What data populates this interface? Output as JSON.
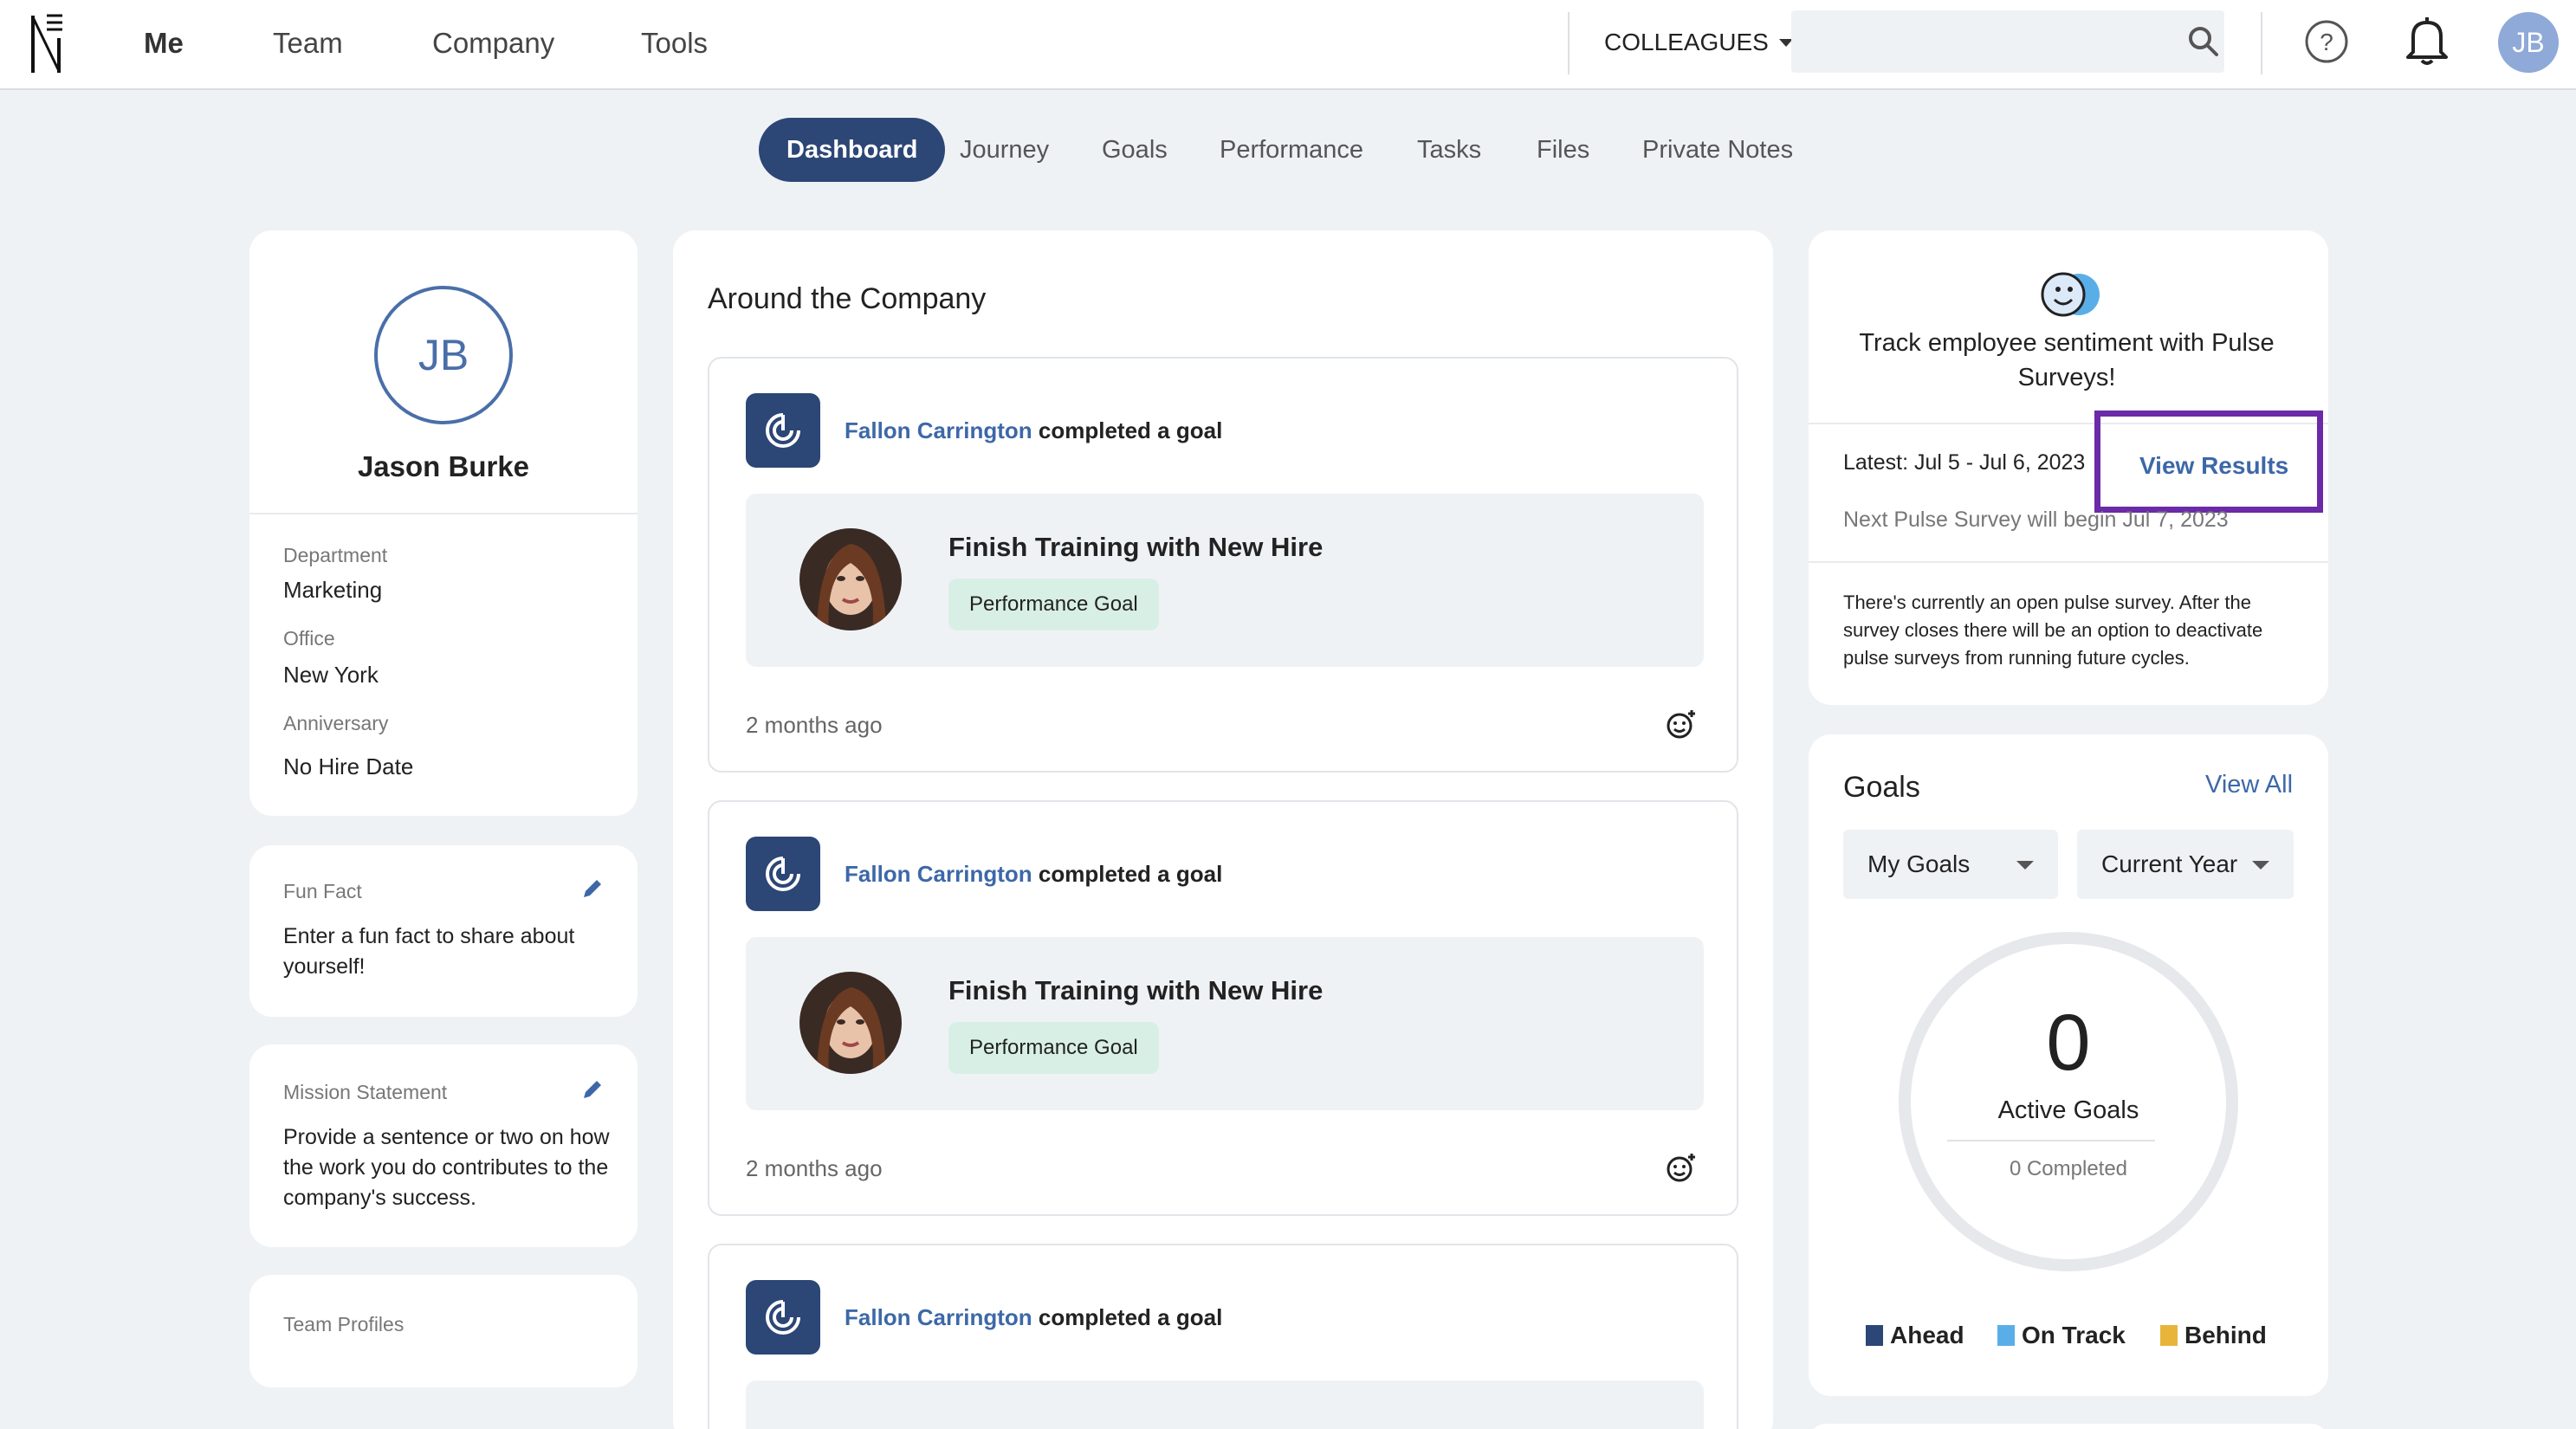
{
  "nav": {
    "items": [
      "Me",
      "Team",
      "Company",
      "Tools"
    ],
    "colleagues_label": "COLLEAGUES",
    "search_placeholder": "",
    "user_initials": "JB"
  },
  "tabs": [
    "Dashboard",
    "Journey",
    "Goals",
    "Performance",
    "Tasks",
    "Files",
    "Private Notes"
  ],
  "profile": {
    "initials": "JB",
    "name": "Jason Burke",
    "fields": [
      {
        "label": "Department",
        "value": "Marketing"
      },
      {
        "label": "Office",
        "value": "New York"
      },
      {
        "label": "Anniversary",
        "value": "No Hire Date"
      }
    ]
  },
  "fun_fact": {
    "label": "Fun Fact",
    "text": "Enter a fun fact to share about yourself!"
  },
  "mission": {
    "label": "Mission Statement",
    "text": "Provide a sentence or two on how the work you do contributes to the company's success."
  },
  "team_profiles": {
    "label": "Team Profiles"
  },
  "feed": {
    "title": "Around the Company",
    "items": [
      {
        "person": "Fallon Carrington",
        "action": "completed a goal",
        "goal_title": "Finish Training with New Hire",
        "badge": "Performance Goal",
        "time": "2 months ago"
      },
      {
        "person": "Fallon Carrington",
        "action": "completed a goal",
        "goal_title": "Finish Training with New Hire",
        "badge": "Performance Goal",
        "time": "2 months ago"
      },
      {
        "person": "Fallon Carrington",
        "action": "completed a goal",
        "goal_title": "",
        "badge": "",
        "time": ""
      }
    ]
  },
  "pulse": {
    "headline": "Track employee sentiment with Pulse Surveys!",
    "latest": "Latest: Jul 5 - Jul 6, 2023",
    "view_results": "View Results",
    "next": "Next Pulse Survey will begin Jul 7, 2023",
    "note": "There's currently an open pulse survey. After the survey closes there will be an option to deactivate pulse surveys from running future cycles."
  },
  "goals": {
    "title": "Goals",
    "view_all": "View All",
    "filter_owner": "My Goals",
    "filter_period": "Current Year",
    "active_count": "0",
    "active_label": "Active Goals",
    "completed_label": "0 Completed",
    "legend": [
      {
        "label": "Ahead",
        "color": "#2c4676"
      },
      {
        "label": "On Track",
        "color": "#5aaee8"
      },
      {
        "label": "Behind",
        "color": "#e8b53a"
      }
    ]
  },
  "colors": {
    "primary": "#2c4676",
    "link": "#3d68a8",
    "highlight_box": "#6b2aa8",
    "badge_bg": "#d8efe6"
  }
}
